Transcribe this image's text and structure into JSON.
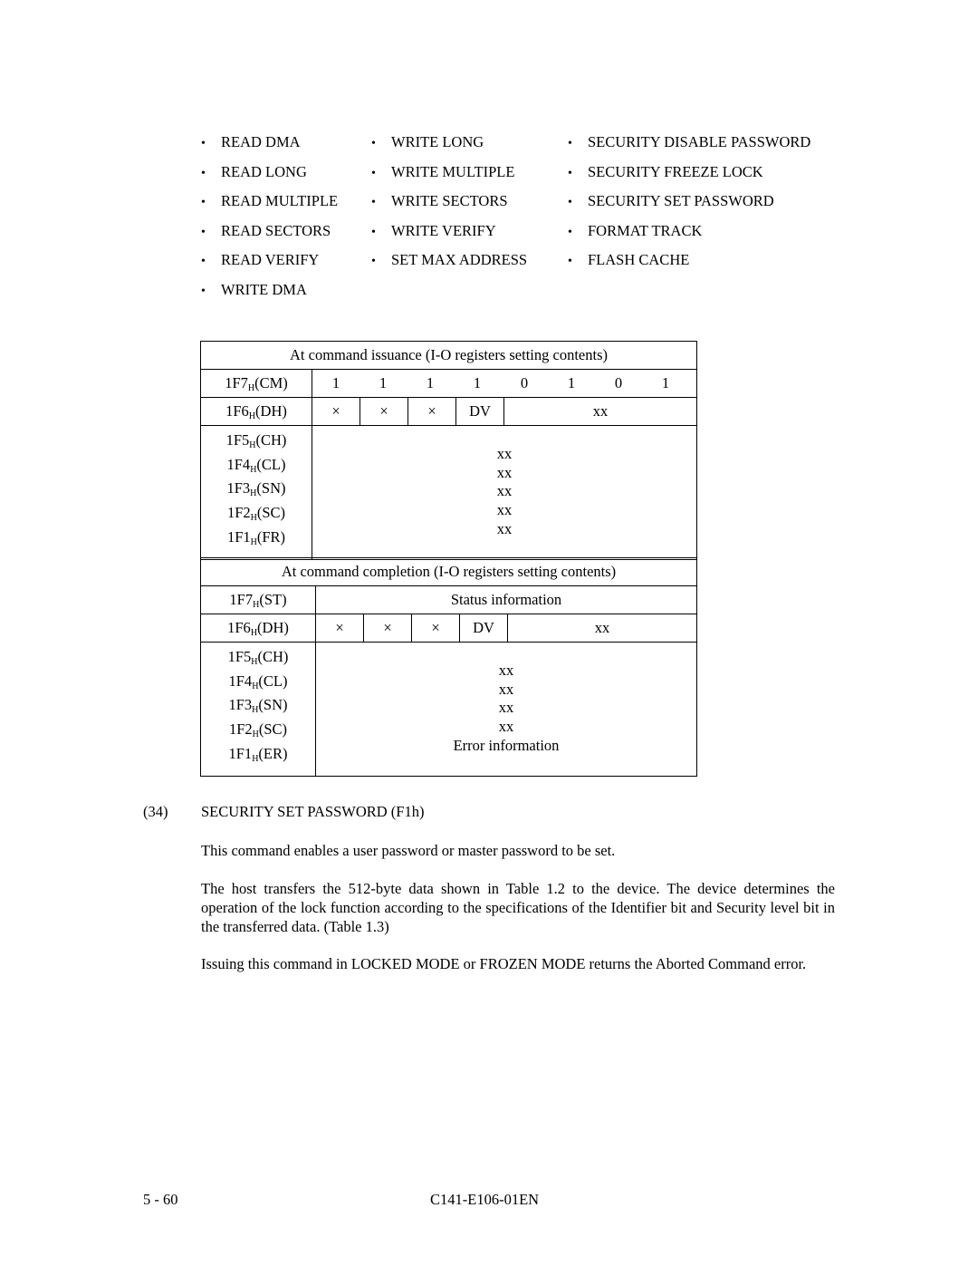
{
  "command_list": {
    "columns": [
      [
        "READ DMA",
        "READ LONG",
        "READ MULTIPLE",
        "READ SECTORS",
        "READ VERIFY",
        "WRITE DMA"
      ],
      [
        "WRITE LONG",
        "WRITE MULTIPLE",
        "WRITE SECTORS",
        "WRITE VERIFY",
        "SET MAX ADDRESS"
      ],
      [
        "SECURITY DISABLE PASSWORD",
        "SECURITY FREEZE LOCK",
        "SECURITY SET PASSWORD",
        "FORMAT TRACK",
        "FLASH CACHE"
      ]
    ]
  },
  "issuance_table": {
    "title": "At command issuance (I-O registers setting contents)",
    "cm": {
      "reg": "1F7",
      "sub": "H",
      "name": "(CM)",
      "bits": [
        "1",
        "1",
        "1",
        "1",
        "0",
        "1",
        "0",
        "1"
      ]
    },
    "dh": {
      "reg": "1F6",
      "sub": "H",
      "name": "(DH)",
      "cells": [
        "×",
        "×",
        "×",
        "DV"
      ],
      "rest": "xx"
    },
    "rows": [
      {
        "reg": "1F5",
        "sub": "H",
        "name": "(CH)",
        "value": "xx"
      },
      {
        "reg": "1F4",
        "sub": "H",
        "name": "(CL)",
        "value": "xx"
      },
      {
        "reg": "1F3",
        "sub": "H",
        "name": "(SN)",
        "value": "xx"
      },
      {
        "reg": "1F2",
        "sub": "H",
        "name": "(SC)",
        "value": "xx"
      },
      {
        "reg": "1F1",
        "sub": "H",
        "name": "(FR)",
        "value": "xx"
      }
    ]
  },
  "completion_table": {
    "title": "At command completion (I-O registers setting contents)",
    "st": {
      "reg": "1F7",
      "sub": "H",
      "name": "(ST)",
      "value": "Status information"
    },
    "dh": {
      "reg": "1F6",
      "sub": "H",
      "name": "(DH)",
      "cells": [
        "×",
        "×",
        "×",
        "DV"
      ],
      "rest": "xx"
    },
    "rows": [
      {
        "reg": "1F5",
        "sub": "H",
        "name": "(CH)",
        "value": "xx"
      },
      {
        "reg": "1F4",
        "sub": "H",
        "name": "(CL)",
        "value": "xx"
      },
      {
        "reg": "1F3",
        "sub": "H",
        "name": "(SN)",
        "value": "xx"
      },
      {
        "reg": "1F2",
        "sub": "H",
        "name": "(SC)",
        "value": "xx"
      },
      {
        "reg": "1F1",
        "sub": "H",
        "name": "(ER)",
        "value": "Error information"
      }
    ]
  },
  "section": {
    "number": "(34)",
    "title": "SECURITY SET PASSWORD (F1h)",
    "paragraphs": [
      "This command enables a user password or master password to be set.",
      "The host transfers the 512-byte data shown in Table 1.2 to the device.  The device determines the operation of the lock function according to the specifications of the Identifier bit and Security level bit in the transferred data.  (Table 1.3)",
      "Issuing this command in LOCKED MODE or FROZEN MODE returns the Aborted Command error."
    ]
  },
  "footer": {
    "page_number": "5 - 60",
    "doc_id": "C141-E106-01EN"
  }
}
